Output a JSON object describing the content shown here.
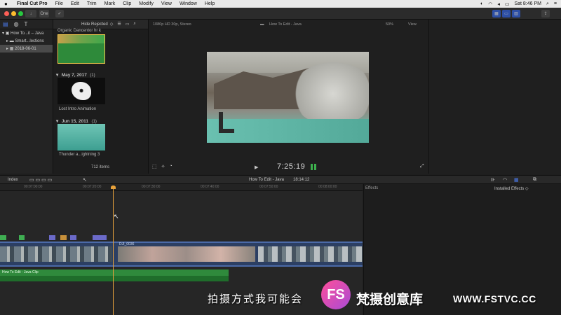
{
  "menubar": {
    "apple": "",
    "app_name": "Final Cut Pro",
    "items": [
      "File",
      "Edit",
      "Trim",
      "Mark",
      "Clip",
      "Modify",
      "View",
      "Window",
      "Help"
    ],
    "clock": "Sat 8:46 PM"
  },
  "toolbar": {
    "one_label": "One"
  },
  "libraries": {
    "library": "How To...it – Java",
    "smart": "Smart...lections",
    "event": "2018-06-01"
  },
  "browser": {
    "filter": "Hide Rejected",
    "top_clip": "Organic Dancentor hr k",
    "groups": [
      {
        "date": "May 7, 2017",
        "count": "(1)",
        "clip": "Lost Intro Animation"
      },
      {
        "date": "Jun 15, 2011",
        "count": "(1)",
        "clip": "Thunder a...ightning 3"
      }
    ],
    "items_count": "712 items"
  },
  "viewer": {
    "format": "1080p HD 30p, Stereo",
    "title": "How To Edit - Java",
    "zoom": "50%",
    "view": "View",
    "timecode": "7:25:19"
  },
  "timeline": {
    "index_label": "Index",
    "project": "How To Edit - Java",
    "duration": "18:14:12",
    "ruler": [
      "00:07:00:00",
      "00:07:20:00",
      "00:07:30:00",
      "00:07:40:00",
      "00:07:50:00",
      "00:08:00:00",
      "00:08:10:00"
    ],
    "clip_label": "DJI_0036",
    "audio_label": "How To Edit - Java Clip"
  },
  "effects": {
    "title": "Effects",
    "installed": "Installed Effects ◇"
  },
  "watermark": {
    "subtitle": "拍摄方式我可能会",
    "logo": "FS",
    "brand": "梵摄创意库",
    "url": "WWW.FSTVC.CC"
  }
}
